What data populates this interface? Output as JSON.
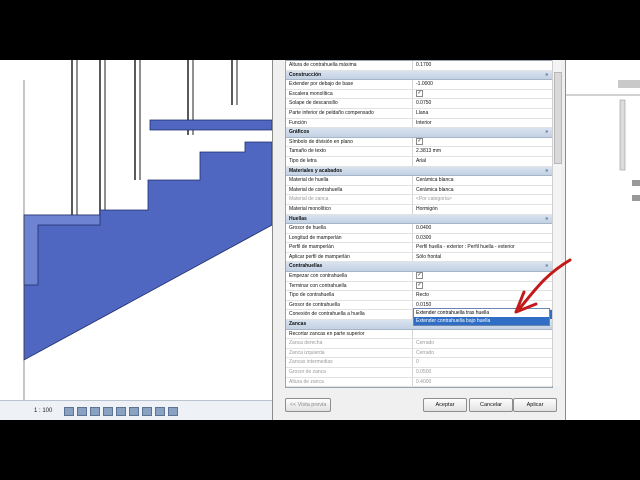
{
  "view": {
    "scale": "1 : 100"
  },
  "dialog": {
    "rows": [
      {
        "type": "row",
        "key": "Altura de contrahuella máxima",
        "value": "0.1700"
      },
      {
        "type": "group",
        "label": "Construcción"
      },
      {
        "type": "row",
        "key": "Extender por debajo de base",
        "value": "-1.0000"
      },
      {
        "type": "row",
        "key": "Escalera monolítica",
        "check": true
      },
      {
        "type": "row",
        "key": "Solape de descansillo",
        "value": "0.0750"
      },
      {
        "type": "row",
        "key": "Parte inferior de peldaño compensado",
        "value": "Llana"
      },
      {
        "type": "row",
        "key": "Función",
        "value": "Interior"
      },
      {
        "type": "group",
        "label": "Gráficos"
      },
      {
        "type": "row",
        "key": "Símbolo de división en plano",
        "check": true
      },
      {
        "type": "row",
        "key": "Tamaño de texto",
        "value": "2.3813 mm"
      },
      {
        "type": "row",
        "key": "Tipo de letra",
        "value": "Arial"
      },
      {
        "type": "group",
        "label": "Materiales y acabados"
      },
      {
        "type": "row",
        "key": "Material de huella",
        "value": "Cerámica blanca"
      },
      {
        "type": "row",
        "key": "Material de contrahuella",
        "value": "Cerámica blanca"
      },
      {
        "type": "row",
        "key": "Material de zanca",
        "value": "<Por categoría>",
        "disabled": true
      },
      {
        "type": "row",
        "key": "Material monolítico",
        "value": "Hormigón"
      },
      {
        "type": "group",
        "label": "Huellas"
      },
      {
        "type": "row",
        "key": "Grosor de huella",
        "value": "0.0400"
      },
      {
        "type": "row",
        "key": "Longitud de mamperlán",
        "value": "0.0300"
      },
      {
        "type": "row",
        "key": "Perfil de mamperlán",
        "value": "Perfil huella - exterior : Perfil huella - exterior"
      },
      {
        "type": "row",
        "key": "Aplicar perfil de mamperlán",
        "value": "Sólo frontal"
      },
      {
        "type": "group",
        "label": "Contrahuellas"
      },
      {
        "type": "row",
        "key": "Empezar con contrahuella",
        "check": true
      },
      {
        "type": "row",
        "key": "Terminar con contrahuella",
        "check": true
      },
      {
        "type": "row",
        "key": "Tipo de contrahuella",
        "value": "Recto"
      },
      {
        "type": "row",
        "key": "Grosor de contrahuella",
        "value": "0.0150"
      },
      {
        "type": "row",
        "key": "Conexión de contrahuella a huella",
        "value": "Extender contrahuella bajo huella",
        "selected": true
      },
      {
        "type": "group",
        "label": "Zancas"
      },
      {
        "type": "row",
        "key": "Recortar zancas en parte superior",
        "value": ""
      },
      {
        "type": "row",
        "key": "Zanca derecha",
        "value": "Cerrado",
        "disabled": true
      },
      {
        "type": "row",
        "key": "Zanca izquierda",
        "value": "Cerrado",
        "disabled": true
      },
      {
        "type": "row",
        "key": "Zancas intermedias",
        "value": "0",
        "disabled": true
      },
      {
        "type": "row",
        "key": "Grosor de zanca",
        "value": "0.0500",
        "disabled": true
      },
      {
        "type": "row",
        "key": "Altura de zanca",
        "value": "0.4000",
        "disabled": true
      },
      {
        "type": "row",
        "key": "Desfase de zanca abierta",
        "value": "0.0000",
        "disabled": true
      },
      {
        "type": "row",
        "key": "Altura de estructura de soporte de zanca",
        "value": "0.1600"
      },
      {
        "type": "row",
        "key": "Altura de estructura de soporte del descansillo",
        "value": "0.2000"
      }
    ],
    "dropdown_options": [
      "Extender contrahuella tras huella",
      "Extender contrahuella bajo huella"
    ],
    "buttons": {
      "preview": "<< Vista previa",
      "accept": "Aceptar",
      "cancel": "Cancelar",
      "apply": "Aplicar"
    }
  }
}
